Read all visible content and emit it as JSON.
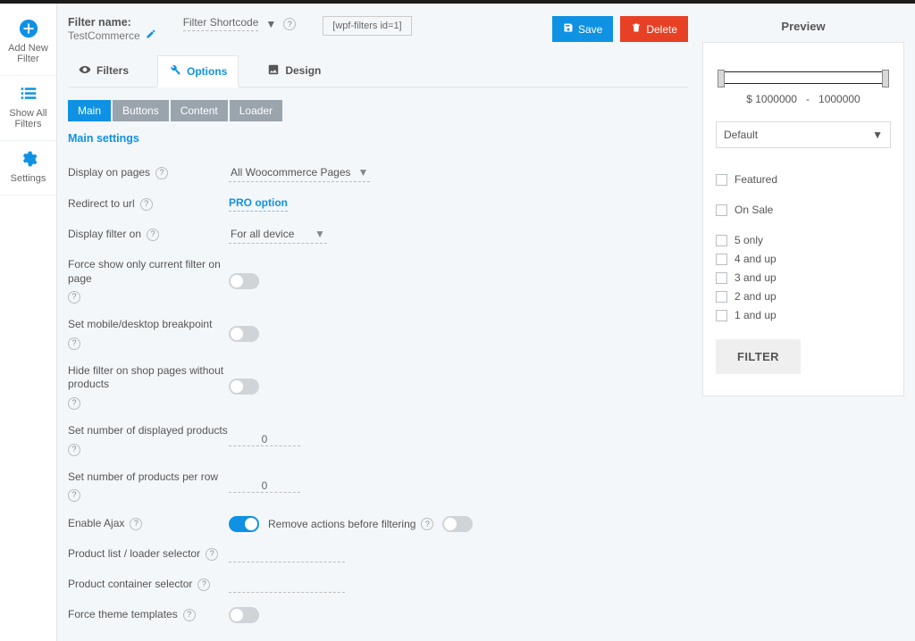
{
  "sidebar": {
    "add": "Add New Filter",
    "all": "Show All Filters",
    "settings": "Settings"
  },
  "header": {
    "filter_name_label": "Filter name:",
    "filter_name_value": "TestCommerce",
    "shortcode_label": "Filter Shortcode",
    "shortcode_value": "[wpf-filters id=1]",
    "save": "Save",
    "delete": "Delete"
  },
  "tabs": {
    "filters": "Filters",
    "options": "Options",
    "design": "Design"
  },
  "subtabs": {
    "main": "Main",
    "buttons": "Buttons",
    "content": "Content",
    "loader": "Loader"
  },
  "section_title": "Main settings",
  "rows": {
    "display_pages_label": "Display on pages",
    "display_pages_value": "All Woocommerce Pages",
    "redirect_label": "Redirect to url",
    "pro": "PRO option",
    "display_filter_on_label": "Display filter on",
    "display_filter_on_value": "For all device",
    "force_show_label": "Force show only current filter on page",
    "breakpoint_label": "Set mobile/desktop breakpoint",
    "hide_empty_label": "Hide filter on shop pages without products",
    "num_displayed_label": "Set number of displayed products",
    "num_displayed_value": "0",
    "per_row_label": "Set number of products per row",
    "per_row_value": "0",
    "enable_ajax_label": "Enable Ajax",
    "remove_actions_label": "Remove actions before filtering",
    "product_list_sel_label": "Product list / loader selector",
    "product_container_sel_label": "Product container selector",
    "force_theme_label": "Force theme templates"
  },
  "preview": {
    "title": "Preview",
    "price_min": "$ 1000000",
    "price_sep": "-",
    "price_max": "1000000",
    "select_default": "Default",
    "featured": "Featured",
    "onsale": "On Sale",
    "ratings": [
      "5 only",
      "4 and up",
      "3 and up",
      "2 and up",
      "1 and up"
    ],
    "filter_btn": "FILTER"
  }
}
